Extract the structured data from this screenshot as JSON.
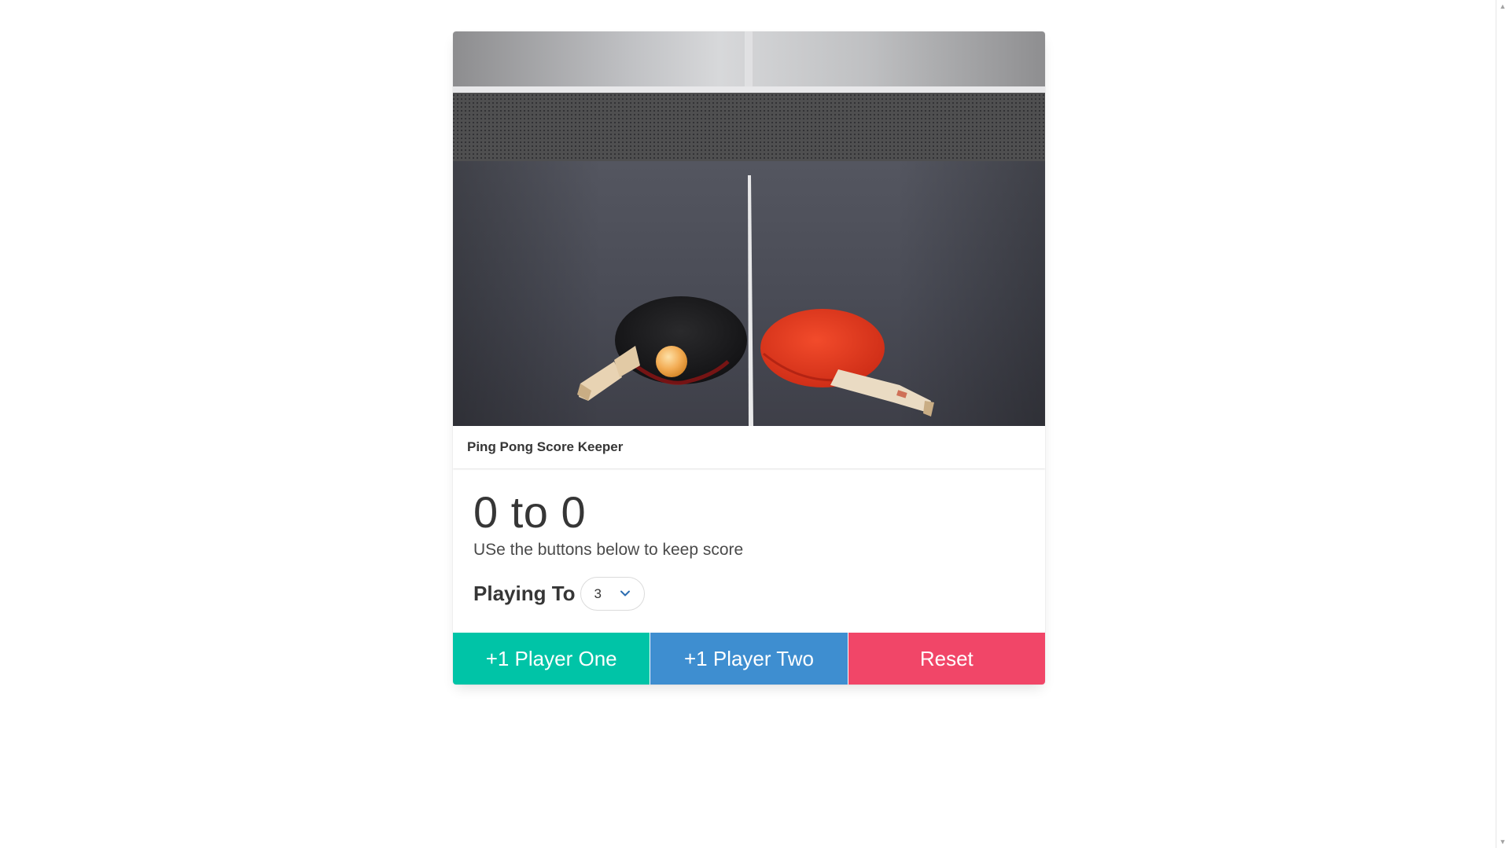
{
  "card": {
    "title": "Ping Pong Score Keeper",
    "score": "0 to 0",
    "subtitle": "USe the buttons below to keep score",
    "playing_to_label": "Playing To",
    "playing_to_value": "3"
  },
  "buttons": {
    "player_one": "+1 Player One",
    "player_two": "+1 Player Two",
    "reset": "Reset"
  },
  "colors": {
    "player_one": "#00c4a7",
    "player_two": "#3e8ed0",
    "reset": "#f14668"
  },
  "icons": {
    "select_arrow": "chevron-down-icon"
  }
}
